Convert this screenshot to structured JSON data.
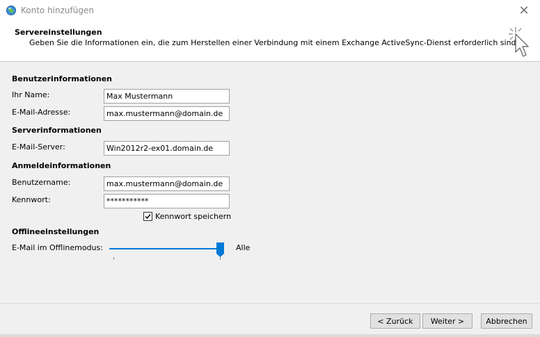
{
  "window": {
    "title": "Konto hinzufügen",
    "close_glyph": "✕"
  },
  "header": {
    "title": "Servereinstellungen",
    "subtitle": "Geben Sie die Informationen ein, die zum Herstellen einer Verbindung mit einem Exchange ActiveSync-Dienst erforderlich sind.",
    "icon": "wizard-cursor-icon"
  },
  "sections": {
    "user_info": "Benutzerinformationen",
    "server_info": "Serverinformationen",
    "logon_info": "Anmeldeinformationen",
    "offline_settings": "Offlineeinstellungen"
  },
  "fields": {
    "name": {
      "label": "Ihr Name:",
      "value": "Max Mustermann"
    },
    "email": {
      "label": "E-Mail-Adresse:",
      "value": "max.mustermann@domain.de"
    },
    "mail_server": {
      "label": "E-Mail-Server:",
      "value": "Win2012r2-ex01.domain.de"
    },
    "username": {
      "label": "Benutzername:",
      "value": "max.mustermann@domain.de"
    },
    "password": {
      "label": "Kennwort:",
      "value": "***********"
    }
  },
  "remember_password": {
    "label": "Kennwort speichern",
    "checked": true
  },
  "offline": {
    "label": "E-Mail im Offlinemodus:",
    "value_label": "Alle",
    "slider_fraction": 1.0
  },
  "buttons": {
    "back": "< Zurück",
    "next": "Weiter >",
    "cancel": "Abbrechen"
  },
  "colors": {
    "accent": "#0078d7",
    "panel": "#f0f0f0"
  }
}
